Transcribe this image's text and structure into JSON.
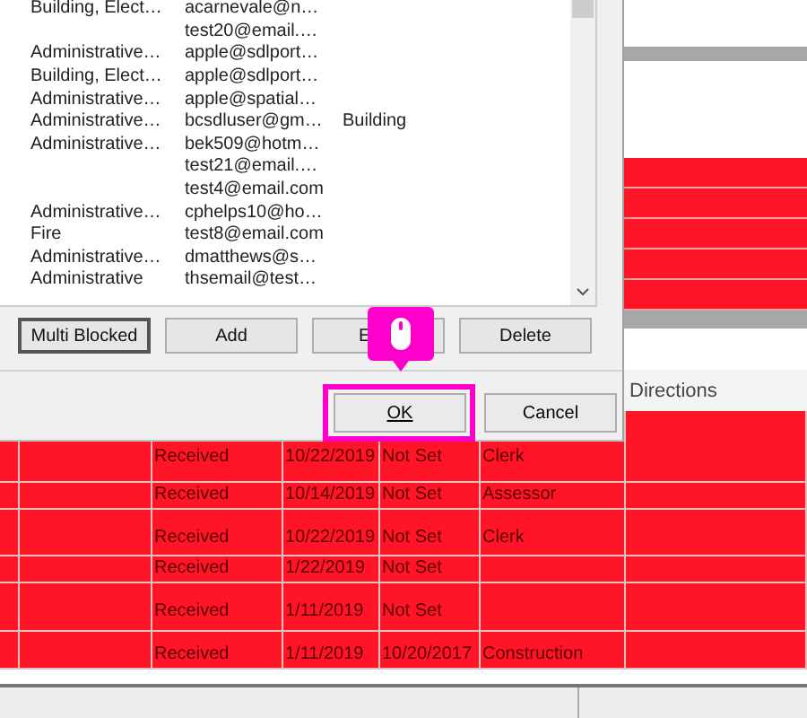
{
  "dialog": {
    "list": {
      "rows": [
        {
          "cells": [
            "Building, Elect…",
            "acarnevale@n…",
            ""
          ]
        },
        {
          "cells": [
            "",
            "test20@email.…",
            ""
          ]
        },
        {
          "cells": [
            "Administrative…",
            "apple@sdlport…",
            ""
          ]
        },
        {
          "cells": [
            "Building, Elect…",
            "apple@sdlport…",
            ""
          ]
        },
        {
          "cells": [
            "Administrative…",
            "apple@spatial…",
            ""
          ]
        },
        {
          "cells": [
            "Administrative…",
            "bcsdluser@gm…",
            "Building"
          ]
        },
        {
          "cells": [
            "Administrative…",
            "bek509@hotm…",
            ""
          ]
        },
        {
          "cells": [
            "",
            "test21@email.…",
            ""
          ]
        },
        {
          "cells": [
            "",
            "test4@email.com",
            ""
          ]
        },
        {
          "cells": [
            "Administrative…",
            "cphelps10@ho…",
            ""
          ]
        },
        {
          "cells": [
            "Fire",
            "test8@email.com",
            ""
          ]
        },
        {
          "cells": [
            "Administrative…",
            "dmatthews@s…",
            ""
          ]
        },
        {
          "cells": [
            "Administrative",
            "thsemail@test…",
            ""
          ]
        }
      ]
    },
    "buttons": [
      {
        "label": "Multi Blocked",
        "default": true
      },
      {
        "label": "Add",
        "default": false
      },
      {
        "label": "E",
        "default": false
      },
      {
        "label": "Delete",
        "default": false
      }
    ],
    "ok": {
      "label": "OK",
      "highlighted": true
    },
    "cancel": {
      "label": "Cancel"
    }
  },
  "table": {
    "header": {
      "last_column": "Directions"
    },
    "rows": [
      {
        "status": "Received",
        "date": "10/22/2019",
        "due": "Not Set",
        "dept": "Clerk"
      },
      {
        "status": "Received",
        "date": "10/14/2019",
        "due": "Not Set",
        "dept": "Assessor"
      },
      {
        "status": "Received",
        "date": "10/22/2019",
        "due": "Not Set",
        "dept": "Clerk"
      },
      {
        "status": "Received",
        "date": "1/22/2019",
        "due": "Not Set",
        "dept": ""
      },
      {
        "status": "Received",
        "date": "1/11/2019",
        "due": "Not Set",
        "dept": ""
      },
      {
        "status": "Received",
        "date": "1/11/2019",
        "due": "10/20/2017",
        "dept": "Construction"
      }
    ]
  }
}
